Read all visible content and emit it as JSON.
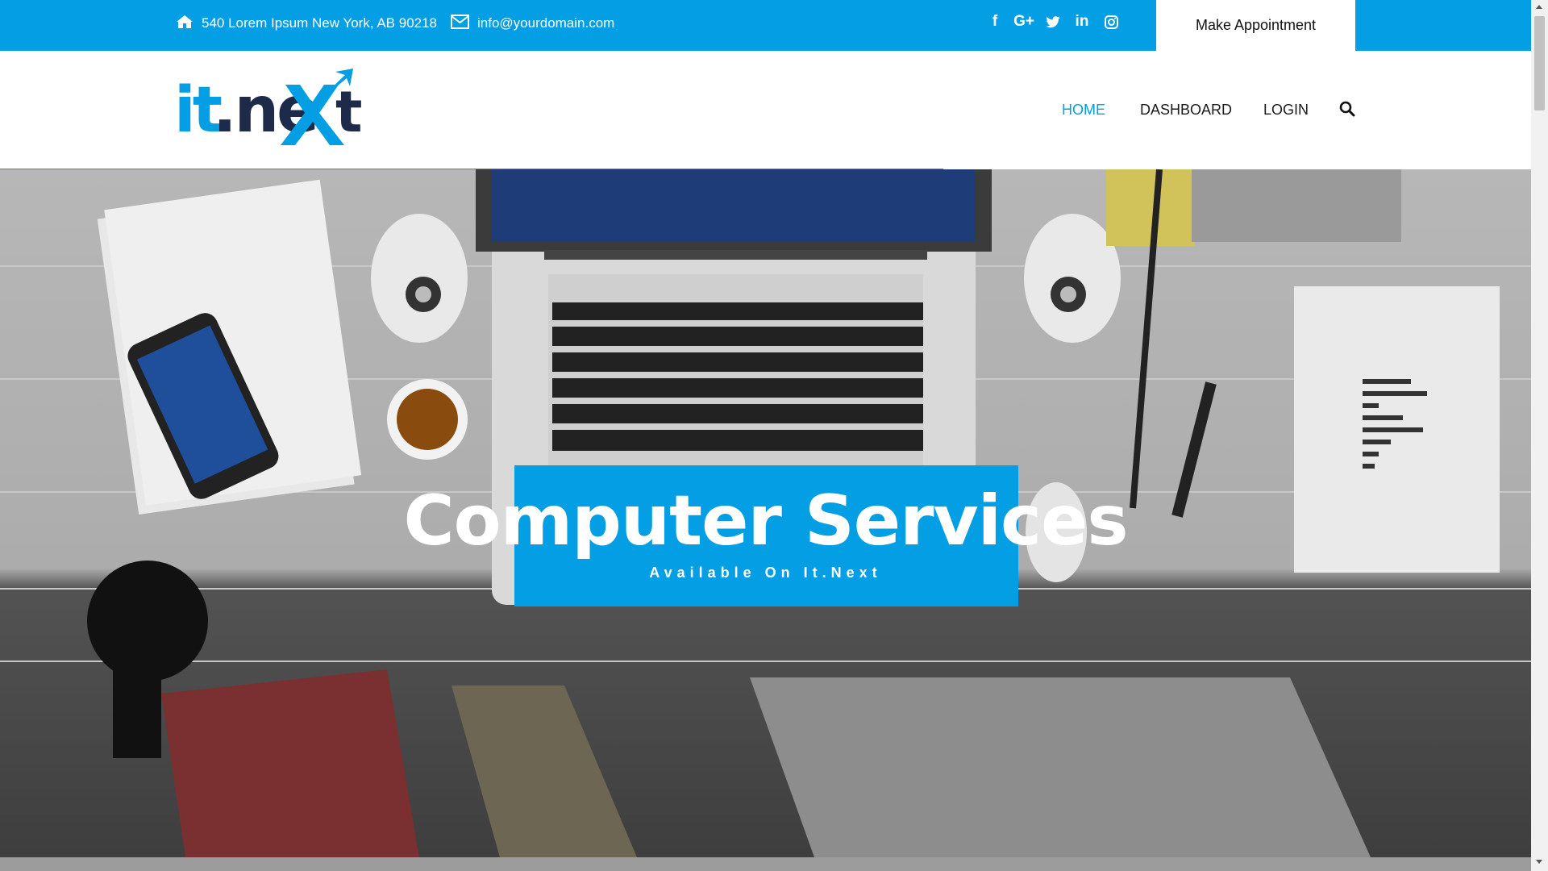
{
  "topbar": {
    "address": "540 Lorem Ipsum New York, AB 90218",
    "email": "info@yourdomain.com",
    "appointment_label": "Make Appointment",
    "social": [
      {
        "icon": "facebook-icon",
        "glyph": "f"
      },
      {
        "icon": "google-plus-icon",
        "glyph": "G+"
      },
      {
        "icon": "twitter-icon",
        "glyph": "t"
      },
      {
        "icon": "linkedin-icon",
        "glyph": "in"
      },
      {
        "icon": "instagram-icon",
        "glyph": "◎"
      }
    ]
  },
  "logo": {
    "text_part1": "it.ne",
    "text_part2": "X",
    "text_part3": "t"
  },
  "nav": {
    "home": "HOME",
    "dashboard": "DASHBOARD",
    "login": "LOGIN",
    "active": "HOME"
  },
  "hero": {
    "title": "Computer Services",
    "subtitle": "Available On It.Next"
  },
  "colors": {
    "accent": "#039ee3",
    "navy": "#1e2a4a"
  }
}
